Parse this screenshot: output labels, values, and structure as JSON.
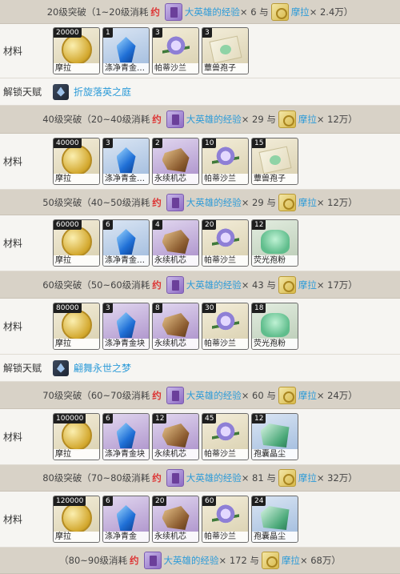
{
  "labels": {
    "materials": "材料",
    "talent": "解锁天赋"
  },
  "colors": {
    "header_bg": "#d8d2c7",
    "link_blue": "#2d9bd8",
    "yue_red": "#d33333"
  },
  "sections": [
    {
      "header": {
        "prefix": "20级突破（1~20级消耗",
        "yue": "约",
        "exp": "大英雄的经验",
        "exp_count": " × 6 与 ",
        "mora": "摩拉",
        "mora_amount": " × 2.4万）"
      },
      "items": [
        {
          "qty": "20000",
          "name": "摩拉",
          "icon": "mora-coin"
        },
        {
          "qty": "1",
          "name": "涤净青金…",
          "icon": "crystal"
        },
        {
          "qty": "3",
          "name": "帕蒂沙兰",
          "icon": "flower"
        },
        {
          "qty": "3",
          "name": "蕈兽孢子",
          "icon": "spore"
        }
      ],
      "talent": "折旋落英之庭"
    },
    {
      "header": {
        "prefix": "40级突破（20~40级消耗",
        "yue": "约",
        "exp": "大英雄的经验",
        "exp_count": " × 29 与 ",
        "mora": "摩拉",
        "mora_amount": " × 12万）"
      },
      "items": [
        {
          "qty": "40000",
          "name": "摩拉",
          "icon": "mora-coin"
        },
        {
          "qty": "3",
          "name": "涤净青金…",
          "icon": "crystal"
        },
        {
          "qty": "2",
          "name": "永续机芯",
          "icon": "mech-chip"
        },
        {
          "qty": "10",
          "name": "帕蒂沙兰",
          "icon": "flower"
        },
        {
          "qty": "15",
          "name": "蕈兽孢子",
          "icon": "spore"
        }
      ]
    },
    {
      "header": {
        "prefix": "50级突破（40~50级消耗",
        "yue": "约",
        "exp": "大英雄的经验",
        "exp_count": " × 29 与 ",
        "mora": "摩拉",
        "mora_amount": " × 12万）"
      },
      "items": [
        {
          "qty": "60000",
          "name": "摩拉",
          "icon": "mora-coin"
        },
        {
          "qty": "6",
          "name": "涤净青金…",
          "icon": "crystal"
        },
        {
          "qty": "4",
          "name": "永续机芯",
          "icon": "mech-chip"
        },
        {
          "qty": "20",
          "name": "帕蒂沙兰",
          "icon": "flower"
        },
        {
          "qty": "12",
          "name": "荧光孢粉",
          "icon": "powder"
        }
      ]
    },
    {
      "header": {
        "prefix": "60级突破（50~60级消耗",
        "yue": "约",
        "exp": "大英雄的经验",
        "exp_count": " × 43 与 ",
        "mora": "摩拉",
        "mora_amount": " × 17万）"
      },
      "items": [
        {
          "qty": "80000",
          "name": "摩拉",
          "icon": "mora-coin"
        },
        {
          "qty": "3",
          "name": "涤净青金块",
          "icon": "crystal"
        },
        {
          "qty": "8",
          "name": "永续机芯",
          "icon": "mech-chip"
        },
        {
          "qty": "30",
          "name": "帕蒂沙兰",
          "icon": "flower"
        },
        {
          "qty": "18",
          "name": "荧光孢粉",
          "icon": "powder"
        }
      ],
      "talent": "翩舞永世之梦"
    },
    {
      "header": {
        "prefix": "70级突破（60~70级消耗",
        "yue": "约",
        "exp": "大英雄的经验",
        "exp_count": " × 60 与 ",
        "mora": "摩拉",
        "mora_amount": " × 24万）"
      },
      "items": [
        {
          "qty": "100000",
          "name": "摩拉",
          "icon": "mora-coin"
        },
        {
          "qty": "6",
          "name": "涤净青金块",
          "icon": "crystal"
        },
        {
          "qty": "12",
          "name": "永续机芯",
          "icon": "mech-chip"
        },
        {
          "qty": "45",
          "name": "帕蒂沙兰",
          "icon": "flower"
        },
        {
          "qty": "12",
          "name": "孢囊晶尘",
          "icon": "dust"
        }
      ]
    },
    {
      "header": {
        "prefix": "80级突破（70~80级消耗",
        "yue": "约",
        "exp": "大英雄的经验",
        "exp_count": " × 81 与 ",
        "mora": "摩拉",
        "mora_amount": " × 32万）"
      },
      "items": [
        {
          "qty": "120000",
          "name": "摩拉",
          "icon": "mora-coin"
        },
        {
          "qty": "6",
          "name": "涤净青金",
          "icon": "crystal"
        },
        {
          "qty": "20",
          "name": "永续机芯",
          "icon": "mech-chip"
        },
        {
          "qty": "60",
          "name": "帕蒂沙兰",
          "icon": "flower"
        },
        {
          "qty": "24",
          "name": "孢囊晶尘",
          "icon": "dust"
        }
      ]
    },
    {
      "header": {
        "prefix": "（80~90级消耗",
        "yue": "约",
        "exp": "大英雄的经验",
        "exp_count": " × 172 与 ",
        "mora": "摩拉",
        "mora_amount": " × 68万）"
      }
    }
  ]
}
